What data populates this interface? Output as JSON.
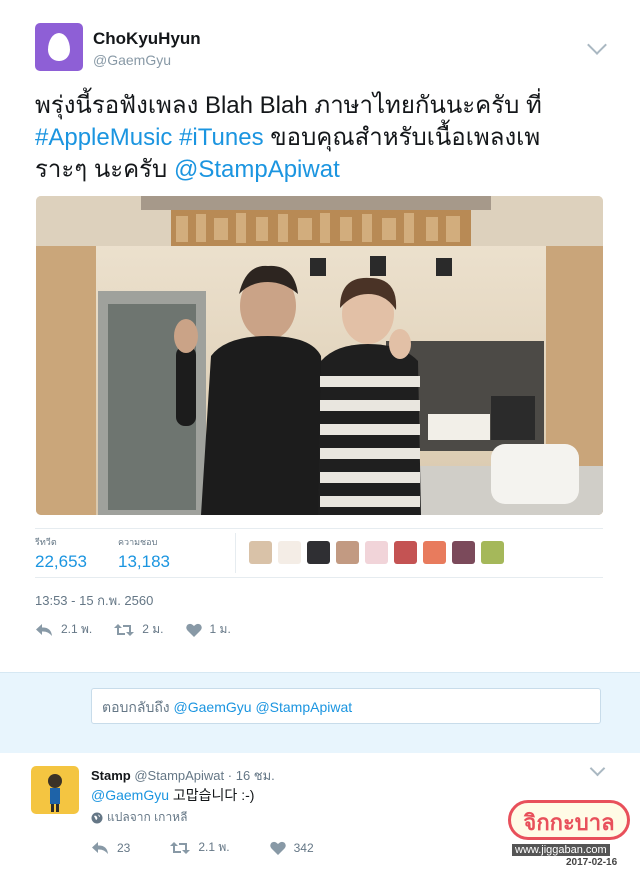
{
  "tweet": {
    "display_name": "ChoKyuHyun",
    "handle": "@GaemGyu",
    "text_part1": "พรุ่งนี้รอฟังเพลง Blah Blah ภาษาไทยกันนะครับ ที่",
    "hashtag1": "#AppleMusic",
    "hashtag2": "#iTunes",
    "text_part2": "ขอบคุณสำหรับเนื้อเพลงเพ",
    "text_part3": "ราะๆ นะครับ",
    "mention": "@StampApiwat",
    "stats": {
      "retweets_label": "รีทวีต",
      "retweets": "22,653",
      "likes_label": "ความชอบ",
      "likes": "13,183"
    },
    "timestamp": "13:53 - 15 ก.พ. 2560",
    "actions": {
      "replies": "2.1 พ.",
      "retweets": "2 ม.",
      "likes": "1 ม."
    }
  },
  "reply_box": {
    "placeholder": "ตอบกลับถึง",
    "mention1": "@GaemGyu",
    "mention2": "@StampApiwat"
  },
  "reply": {
    "display_name": "Stamp",
    "handle": "@StampApiwat",
    "time": "· 16 ชม.",
    "mention": "@GaemGyu",
    "text": "고맙습니다 :-)",
    "translate": "แปลจาก เกาหลี",
    "actions": {
      "replies": "23",
      "retweets": "2.1 พ.",
      "likes": "342"
    }
  },
  "watermark": {
    "logo_text": "จิกกะบาล",
    "url": "www.jiggaban.com",
    "date": "2017-02-16"
  },
  "colors": {
    "accent": "#1b95e0",
    "egg_avatar": "#8e5fd6",
    "reply_band": "#e8f5fd"
  }
}
